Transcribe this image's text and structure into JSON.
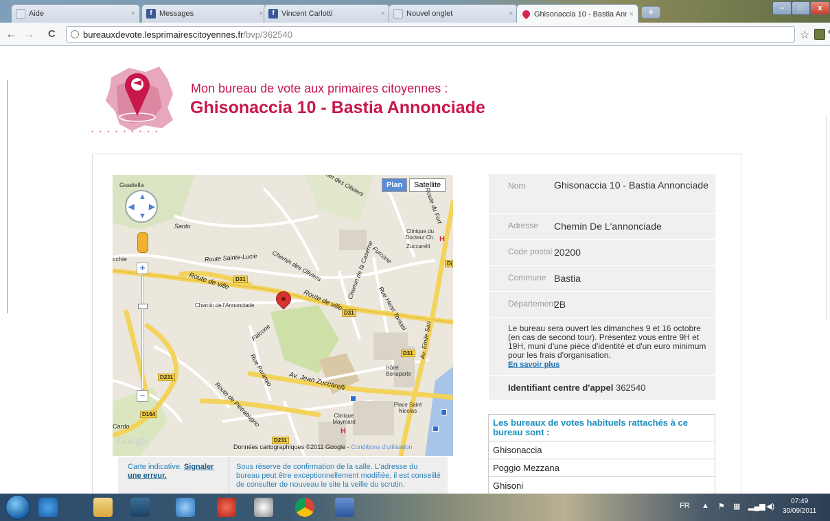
{
  "browser": {
    "tabs": [
      {
        "title": "Aide",
        "icon": "page-icon",
        "active": false
      },
      {
        "title": "Messages",
        "icon": "facebook-icon",
        "active": false
      },
      {
        "title": "Vincent Carlotti",
        "icon": "facebook-icon",
        "active": false
      },
      {
        "title": "Nouvel onglet",
        "icon": "page-icon",
        "active": false
      },
      {
        "title": "Ghisonaccia 10 - Bastia Ann",
        "icon": "primaires-pin-icon",
        "active": true
      }
    ],
    "close_glyph": "×",
    "newtab_glyph": "+",
    "url_host": "bureauxdevote.lesprimairescitoyennes.fr",
    "url_path": "/bvp/362540",
    "nav": {
      "back": "←",
      "forward": "→",
      "reload": "C"
    },
    "window": {
      "minimize": "–",
      "maximize": "□",
      "close": "x"
    }
  },
  "page": {
    "heading_sub": "Mon bureau de vote aux primaires citoyennes :",
    "heading_main": "Ghisonaccia 10 - Bastia Annonciade",
    "logo_tagline": "• • • • • • • • •",
    "accent_color": "#c8174a"
  },
  "map": {
    "type_buttons": {
      "plan": "Plan",
      "satellite": "Satellite"
    },
    "zoom_in": "+",
    "zoom_out": "–",
    "place_labels": {
      "guaitella": "Guaitella",
      "chie": "cchie",
      "santo": "Santo",
      "clinique_docteur": "Clinique du Docteur Ch.",
      "zuccarelli": "Zuccarelli",
      "hotel_bonaparte": "Hôtel Bonaparte",
      "place_saint_nicolas": "Place Saint Nicolas",
      "clinique_maymard": "Clinique Maymard",
      "cardo": "Cardo"
    },
    "road_labels": {
      "chemin_oliviers_top": "Chemin des Oliviers",
      "route_du_fort": "Route du Fort",
      "route_sainte_lucie": "Route Sainte-Lucie",
      "chemin_des_oliviers": "Chemin des Oliviers",
      "chemin_de_la_caserne": "Chemin de la Caserne",
      "furcone": "Furcone",
      "route_de_ville_1": "Route de ville",
      "route_de_ville_2": "Route de ville",
      "chemin_annonciade": "Chemin de l'Annonciade",
      "falcone": "Falcone",
      "rue_henri_tomasi": "Rue Henri Tomasi",
      "av_emile_sari": "Av. Emile Sari",
      "av_jean_zuccarelli": "Av. Jean Zuccarelli",
      "rue_paratojo": "Rue Paratojo",
      "route_de_pietrabugno": "Route de Pietrabugno"
    },
    "shields": {
      "d31a": "D31",
      "d31b": "D31",
      "d31c": "D31",
      "d231a": "D231",
      "d231b": "D231",
      "d164": "D164",
      "d_cut": "D("
    },
    "hospital_mark": "H",
    "google_logo": "Google",
    "copyright": "Données cartographiques ©2011 Google - ",
    "terms_link": "Conditions d'utilisation"
  },
  "notes": {
    "left_prefix": "Carte indicative. ",
    "left_link": "Signaler une erreur.",
    "right": "Sous réserve de confirmation de la salle. L'adresse du bureau peut être exceptionnellement modifiée, il est conseillé de consulter de nouveau le site la veille du scrutin."
  },
  "info": {
    "rows": [
      {
        "label": "Nom",
        "value": "Ghisonaccia 10 - Bastia Annonciade"
      },
      {
        "label": "Adresse",
        "value": "Chemin De L'annonciade"
      },
      {
        "label": "Code postal",
        "value": "20200"
      },
      {
        "label": "Commune",
        "value": "Bastia"
      },
      {
        "label": "Département",
        "value": "2B"
      }
    ],
    "note": "Le bureau sera ouvert les dimanches 9 et 16 octobre (en cas de second tour). Présentez vous entre 9H et 19H, muni d'une pièce d'identité et d'un euro minimum pour les frais d'organisation.",
    "more_link": "En savoir plus",
    "id_label": "Identifiant centre d'appel",
    "id_value": "362540"
  },
  "bureaux": {
    "title": "Les bureaux de votes habituels rattachés à ce bureau sont :",
    "items": [
      "Ghisonaccia",
      "Poggio Mezzana",
      "Ghisoni"
    ]
  },
  "taskbar": {
    "lang": "FR",
    "time": "07:49",
    "date": "30/09/2011"
  }
}
